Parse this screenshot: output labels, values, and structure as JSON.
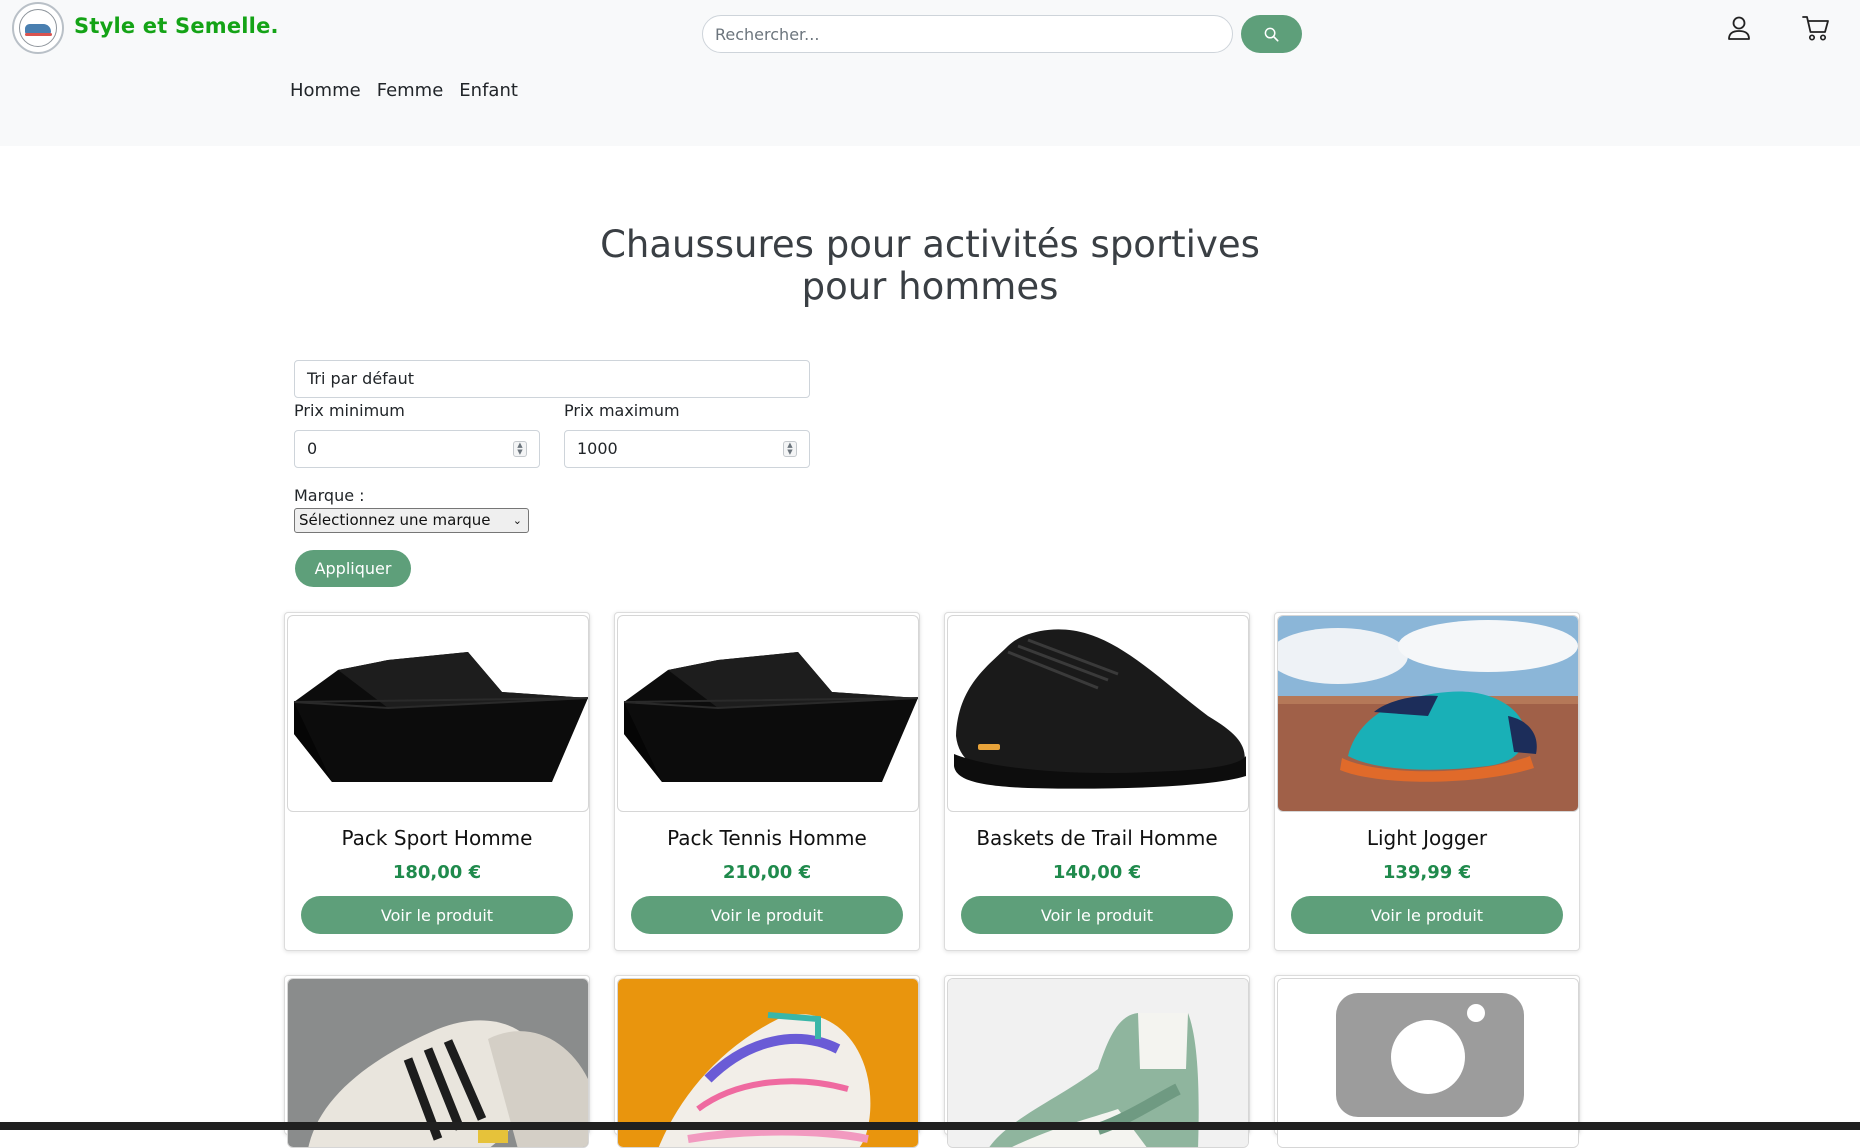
{
  "header": {
    "brand": "Style et Semelle.",
    "search_placeholder": "Rechercher...",
    "nav": [
      "Homme",
      "Femme",
      "Enfant"
    ],
    "icons": {
      "search": "search-icon",
      "user": "user-icon",
      "cart": "cart-icon"
    }
  },
  "page": {
    "title_line1": "Chaussures pour activités sportives",
    "title_line2": "pour hommes"
  },
  "filters": {
    "sort_value": "Tri par défaut",
    "min_label": "Prix minimum",
    "min_value": "0",
    "max_label": "Prix maximum",
    "max_value": "1000",
    "brand_label": "Marque :",
    "brand_value": "Sélectionnez une marque",
    "apply_label": "Appliquer"
  },
  "products": [
    {
      "name": "Pack Sport Homme",
      "price": "180,00 €",
      "button": "Voir le produit",
      "image": "black-box"
    },
    {
      "name": "Pack Tennis Homme",
      "price": "210,00 €",
      "button": "Voir le produit",
      "image": "black-box"
    },
    {
      "name": "Baskets de Trail Homme",
      "price": "140,00 €",
      "button": "Voir le produit",
      "image": "black-trail-shoe"
    },
    {
      "name": "Light Jogger",
      "price": "139,99 €",
      "button": "Voir le produit",
      "image": "teal-orange-running-shoe"
    },
    {
      "image": "white-black-striped-sneakers"
    },
    {
      "image": "colorful-tennis-shoe"
    },
    {
      "image": "green-white-high-top-sneaker"
    },
    {
      "image": "camera-placeholder"
    }
  ],
  "colors": {
    "brand": "#14a316",
    "accent": "#5e9f7a",
    "price": "#1f8a4c"
  }
}
